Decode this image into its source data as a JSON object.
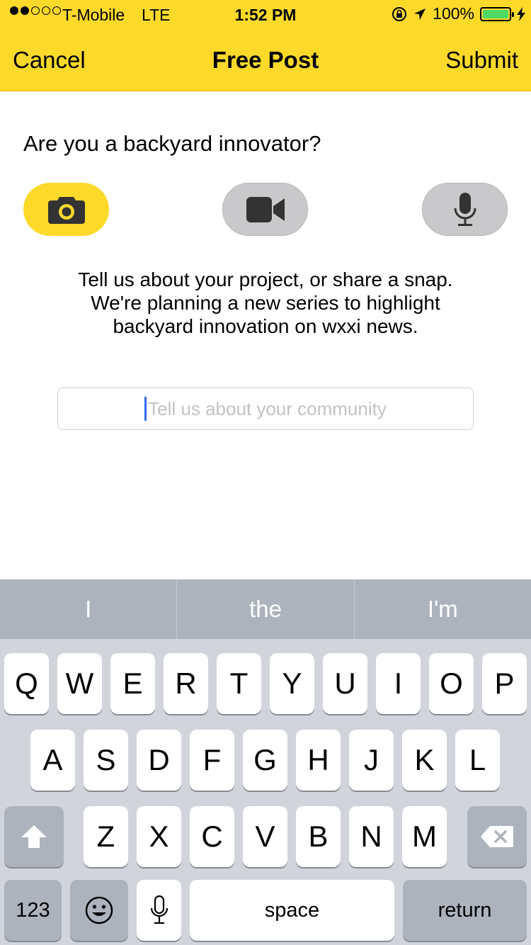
{
  "status_bar": {
    "carrier": "T-Mobile",
    "network": "LTE",
    "time": "1:52 PM",
    "battery": "100%",
    "signal_bars_filled": 2,
    "signal_bars_total": 5
  },
  "nav": {
    "cancel_label": "Cancel",
    "title": "Free Post",
    "submit_label": "Submit"
  },
  "question": "Are you a backyard innovator?",
  "media_buttons": [
    {
      "name": "photo",
      "icon": "camera-icon",
      "active": true
    },
    {
      "name": "video",
      "icon": "video-camera-icon",
      "active": false
    },
    {
      "name": "audio",
      "icon": "microphone-icon",
      "active": false
    }
  ],
  "description": {
    "line1": "Tell us about your project, or share a snap.",
    "line2": "We're planning a new series to highlight",
    "line3": "backyard innovation on wxxi news."
  },
  "input": {
    "placeholder": "Tell us about your community",
    "value": ""
  },
  "keyboard": {
    "suggestions": [
      "I",
      "the",
      "I'm"
    ],
    "row1": [
      "Q",
      "W",
      "E",
      "R",
      "T",
      "Y",
      "U",
      "I",
      "O",
      "P"
    ],
    "row2": [
      "A",
      "S",
      "D",
      "F",
      "G",
      "H",
      "J",
      "K",
      "L"
    ],
    "row3": [
      "Z",
      "X",
      "C",
      "V",
      "B",
      "N",
      "M"
    ],
    "numbers_label": "123",
    "space_label": "space",
    "return_label": "return"
  },
  "colors": {
    "accent": "#fdd92a",
    "inactive_button": "#c9c9cb",
    "cursor": "#2f6cf5",
    "battery": "#4cd964"
  }
}
